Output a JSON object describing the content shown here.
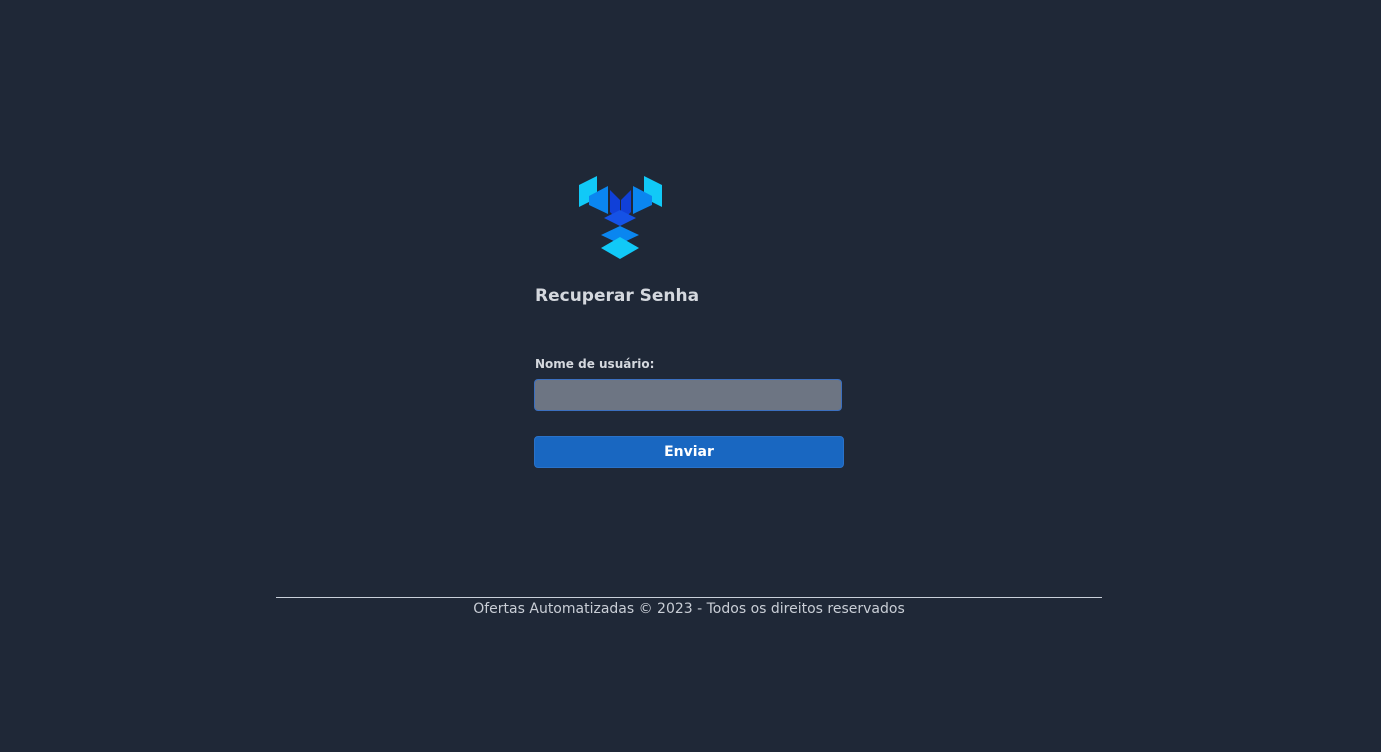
{
  "logo": {
    "icon": "cube-stack-logo-icon",
    "colors": {
      "light": "#11c9f7",
      "mid": "#0a86f0",
      "dark": "#1040d8"
    }
  },
  "form": {
    "title": "Recuperar Senha",
    "username_label": "Nome de usuário:",
    "username_value": "",
    "username_placeholder": "",
    "submit_label": "Enviar"
  },
  "footer": {
    "text": "Ofertas Automatizadas © 2023 - Todos os direitos reservados"
  },
  "colors": {
    "background": "#1f2837",
    "input_bg": "#6d7583",
    "button_bg": "#1967c1",
    "text": "#d4d8de"
  }
}
